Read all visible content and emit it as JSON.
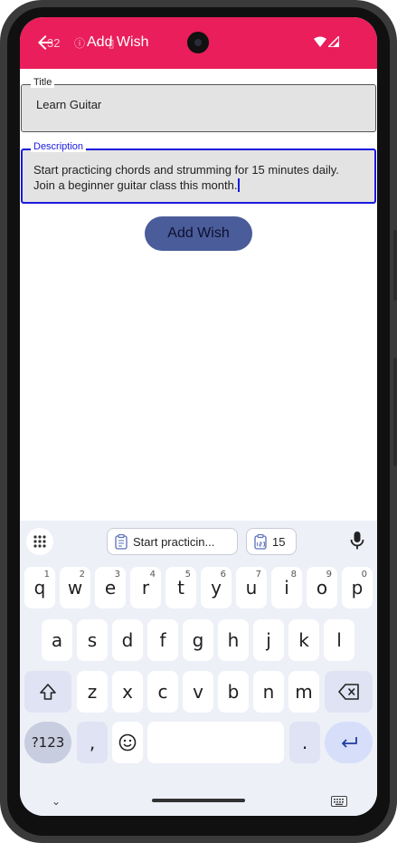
{
  "status_bar": {
    "time": "32",
    "left_icons": "ⓘ ◔ ▯",
    "wifi_icon": "wifi-icon",
    "signal_icon": "signal-icon"
  },
  "app_bar": {
    "title": "Add Wish",
    "back_icon": "arrow-left-icon",
    "color": "#e91e5a"
  },
  "form": {
    "title_field": {
      "label": "Title",
      "value": "Learn Guitar"
    },
    "description_field": {
      "label": "Description",
      "value": "Start practicing chords and strumming for 15 minutes daily. Join a beginner guitar class this month."
    },
    "submit_label": "Add Wish",
    "accent_color": "#1a1ae0",
    "button_color": "#4a5c9a"
  },
  "keyboard": {
    "suggestions": [
      {
        "icon": "clipboard-icon",
        "label": "Start practicin..."
      },
      {
        "icon": "clipboard-numbers-icon",
        "label": "15"
      }
    ],
    "row1": [
      {
        "label": "q",
        "hint": "1"
      },
      {
        "label": "w",
        "hint": "2"
      },
      {
        "label": "e",
        "hint": "3"
      },
      {
        "label": "r",
        "hint": "4"
      },
      {
        "label": "t",
        "hint": "5"
      },
      {
        "label": "y",
        "hint": "6"
      },
      {
        "label": "u",
        "hint": "7"
      },
      {
        "label": "i",
        "hint": "8"
      },
      {
        "label": "o",
        "hint": "9"
      },
      {
        "label": "p",
        "hint": "0"
      }
    ],
    "row2": [
      "a",
      "s",
      "d",
      "f",
      "g",
      "h",
      "j",
      "k",
      "l"
    ],
    "row3": [
      "z",
      "x",
      "c",
      "v",
      "b",
      "n",
      "m"
    ],
    "symbols_label": "?123",
    "comma_label": ",",
    "period_label": ".",
    "emoji_icon": "smiley-icon",
    "shift_icon": "shift-arrow-icon",
    "backspace_icon": "backspace-icon",
    "enter_icon": "enter-return-icon",
    "apps_icon": "grid-dots-icon",
    "mic_icon": "microphone-icon"
  },
  "nav_bar": {
    "hide_keyboard_icon": "chevron-down-icon",
    "switch_keyboard_icon": "keyboard-icon"
  }
}
